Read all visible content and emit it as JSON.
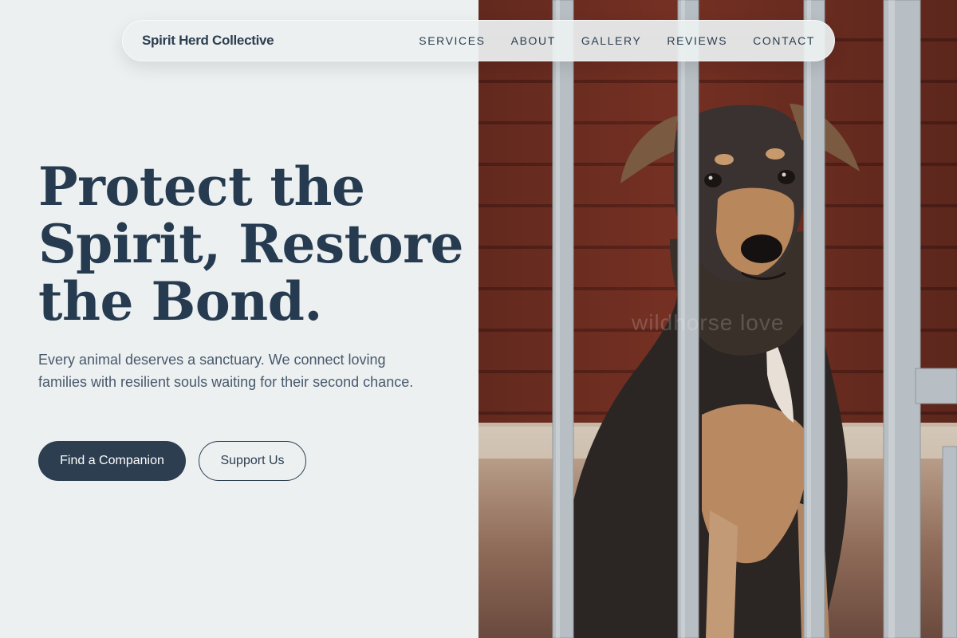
{
  "nav": {
    "brand": "Spirit Herd Collective",
    "links": [
      "SERVICES",
      "ABOUT",
      "GALLERY",
      "REVIEWS",
      "CONTACT"
    ]
  },
  "hero": {
    "title_lines": [
      "Protect the",
      "Spirit, Restore",
      "the Bond."
    ],
    "subtitle": "Every animal deserves a sanctuary. We connect loving families with resilient souls waiting for their second chance.",
    "primary_button": "Find a Companion",
    "secondary_button": "Support Us"
  },
  "photo": {
    "subject": "dog behind metal gate bars",
    "watermark": "wildhorse love"
  },
  "colors": {
    "background": "#ecf0f1",
    "primary": "#2c3e50",
    "text_muted": "#48596b"
  }
}
